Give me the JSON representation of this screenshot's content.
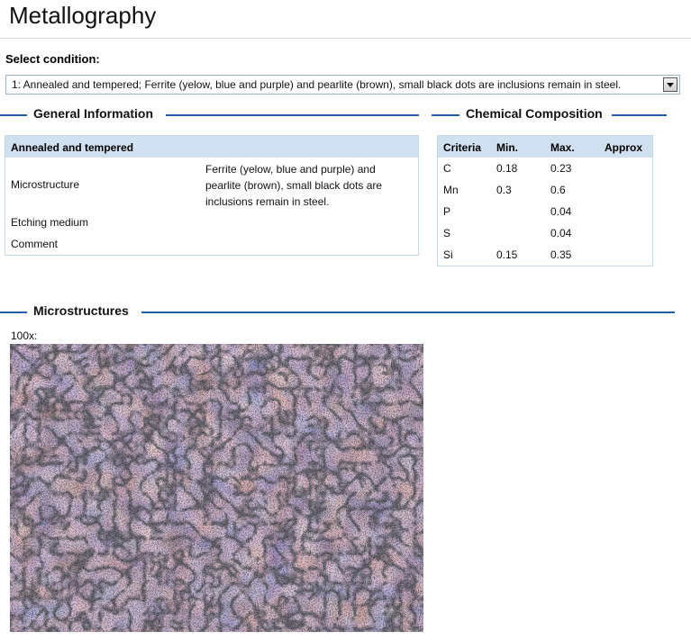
{
  "page": {
    "title": "Metallography"
  },
  "condition": {
    "label": "Select condition:",
    "selected": "1: Annealed and tempered; Ferrite (yelow, blue and purple) and pearlite (brown), small black dots are inclusions remain in steel."
  },
  "general": {
    "heading": "General Information",
    "table_header": "Annealed and tempered",
    "rows": [
      {
        "label": "Microstructure",
        "value": "Ferrite (yelow, blue and purple) and pearlite (brown), small black dots are inclusions remain in steel."
      },
      {
        "label": "Etching medium",
        "value": ""
      },
      {
        "label": "Comment",
        "value": ""
      }
    ]
  },
  "chemical": {
    "heading": "Chemical Composition",
    "columns": [
      "Criteria",
      "Min.",
      "Max.",
      "Approx"
    ],
    "rows": [
      {
        "criteria": "C",
        "min": "0.18",
        "max": "0.23",
        "approx": ""
      },
      {
        "criteria": "Mn",
        "min": "0.3",
        "max": "0.6",
        "approx": ""
      },
      {
        "criteria": "P",
        "min": "",
        "max": "0.04",
        "approx": ""
      },
      {
        "criteria": "S",
        "min": "",
        "max": "0.04",
        "approx": ""
      },
      {
        "criteria": "Si",
        "min": "0.15",
        "max": "0.35",
        "approx": ""
      }
    ]
  },
  "microstructures": {
    "heading": "Microstructures",
    "magnification": "100x:"
  },
  "colors": {
    "accent": "#1f5fa8",
    "panel_header": "#cfe0f1",
    "panel_border": "#c7d7e6"
  }
}
